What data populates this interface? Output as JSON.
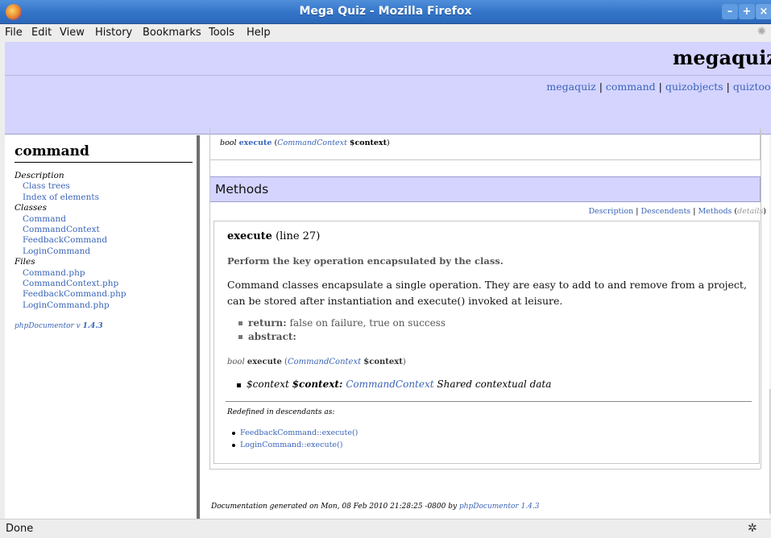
{
  "window": {
    "title": "Mega Quiz - Mozilla Firefox",
    "min_glyph": "–",
    "max_glyph": "+",
    "close_glyph": "×"
  },
  "menu": [
    "File",
    "Edit",
    "View",
    "History",
    "Bookmarks",
    "Tools",
    "Help"
  ],
  "header": {
    "brand": "megaquiz",
    "links": [
      "megaquiz",
      "command",
      "quizobjects",
      "quiztools"
    ],
    "sep": " | "
  },
  "left": {
    "title": "command",
    "desc_heading": "Description",
    "desc_links": [
      "Class trees",
      "Index of elements"
    ],
    "classes_heading": "Classes",
    "classes": [
      "Command",
      "CommandContext",
      "FeedbackCommand",
      "LoginCommand"
    ],
    "files_heading": "Files",
    "files": [
      "Command.php",
      "CommandContext.php",
      "FeedbackCommand.php",
      "LoginCommand.php"
    ],
    "generator": "phpDocumentor v",
    "generator_version": "1.4.3"
  },
  "summary": {
    "type": "bool",
    "name": "execute",
    "param_type": "CommandContext",
    "param_var": "$context"
  },
  "methods": {
    "heading": "Methods",
    "nav": [
      "Description",
      "Descendents",
      "Methods"
    ],
    "nav_details": "details",
    "method_name": "execute",
    "method_line": "(line 27)",
    "short_desc": "Perform the key operation encapsulated by the class.",
    "long_desc": "Command classes encapsulate a single operation. They are easy to add to and remove from a project, can be stored after instantiation and execute() invoked at leisure.",
    "tags": [
      {
        "label": "return:",
        "value": "false on failure, true on success"
      },
      {
        "label": "abstract:",
        "value": ""
      }
    ],
    "sig_type": "bool",
    "sig_name": "execute",
    "sig_param_type": "CommandContext",
    "sig_param_var": "$context",
    "param_type": "$context",
    "param_name": "$context:",
    "param_link": "CommandContext",
    "param_desc": "Shared contextual data",
    "redefined_heading": "Redefined in descendants as:",
    "redefined": [
      "FeedbackCommand::execute()",
      "LoginCommand::execute()"
    ]
  },
  "footer": {
    "text": "Documentation generated on Mon, 08 Feb 2010 21:28:25 -0800 by",
    "link": "phpDocumentor 1.4.3"
  },
  "status": {
    "text": "Done"
  }
}
